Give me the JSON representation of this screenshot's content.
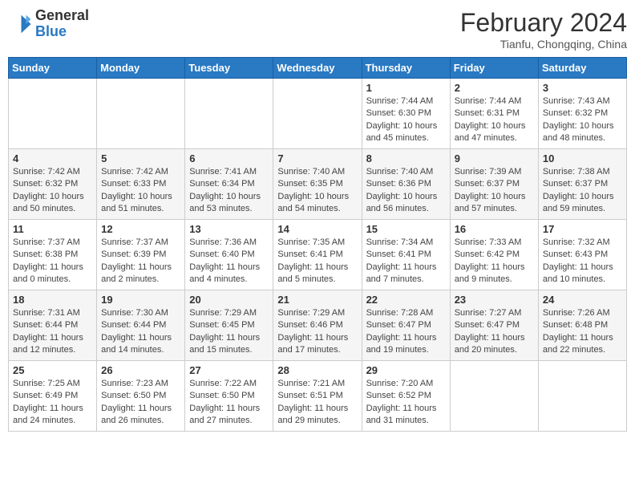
{
  "header": {
    "logo": {
      "general": "General",
      "blue": "Blue"
    },
    "title": "February 2024",
    "location": "Tianfu, Chongqing, China"
  },
  "days_of_week": [
    "Sunday",
    "Monday",
    "Tuesday",
    "Wednesday",
    "Thursday",
    "Friday",
    "Saturday"
  ],
  "weeks": [
    [
      {
        "day": null,
        "info": null
      },
      {
        "day": null,
        "info": null
      },
      {
        "day": null,
        "info": null
      },
      {
        "day": null,
        "info": null
      },
      {
        "day": "1",
        "info": "Sunrise: 7:44 AM\nSunset: 6:30 PM\nDaylight: 10 hours\nand 45 minutes."
      },
      {
        "day": "2",
        "info": "Sunrise: 7:44 AM\nSunset: 6:31 PM\nDaylight: 10 hours\nand 47 minutes."
      },
      {
        "day": "3",
        "info": "Sunrise: 7:43 AM\nSunset: 6:32 PM\nDaylight: 10 hours\nand 48 minutes."
      }
    ],
    [
      {
        "day": "4",
        "info": "Sunrise: 7:42 AM\nSunset: 6:32 PM\nDaylight: 10 hours\nand 50 minutes."
      },
      {
        "day": "5",
        "info": "Sunrise: 7:42 AM\nSunset: 6:33 PM\nDaylight: 10 hours\nand 51 minutes."
      },
      {
        "day": "6",
        "info": "Sunrise: 7:41 AM\nSunset: 6:34 PM\nDaylight: 10 hours\nand 53 minutes."
      },
      {
        "day": "7",
        "info": "Sunrise: 7:40 AM\nSunset: 6:35 PM\nDaylight: 10 hours\nand 54 minutes."
      },
      {
        "day": "8",
        "info": "Sunrise: 7:40 AM\nSunset: 6:36 PM\nDaylight: 10 hours\nand 56 minutes."
      },
      {
        "day": "9",
        "info": "Sunrise: 7:39 AM\nSunset: 6:37 PM\nDaylight: 10 hours\nand 57 minutes."
      },
      {
        "day": "10",
        "info": "Sunrise: 7:38 AM\nSunset: 6:37 PM\nDaylight: 10 hours\nand 59 minutes."
      }
    ],
    [
      {
        "day": "11",
        "info": "Sunrise: 7:37 AM\nSunset: 6:38 PM\nDaylight: 11 hours\nand 0 minutes."
      },
      {
        "day": "12",
        "info": "Sunrise: 7:37 AM\nSunset: 6:39 PM\nDaylight: 11 hours\nand 2 minutes."
      },
      {
        "day": "13",
        "info": "Sunrise: 7:36 AM\nSunset: 6:40 PM\nDaylight: 11 hours\nand 4 minutes."
      },
      {
        "day": "14",
        "info": "Sunrise: 7:35 AM\nSunset: 6:41 PM\nDaylight: 11 hours\nand 5 minutes."
      },
      {
        "day": "15",
        "info": "Sunrise: 7:34 AM\nSunset: 6:41 PM\nDaylight: 11 hours\nand 7 minutes."
      },
      {
        "day": "16",
        "info": "Sunrise: 7:33 AM\nSunset: 6:42 PM\nDaylight: 11 hours\nand 9 minutes."
      },
      {
        "day": "17",
        "info": "Sunrise: 7:32 AM\nSunset: 6:43 PM\nDaylight: 11 hours\nand 10 minutes."
      }
    ],
    [
      {
        "day": "18",
        "info": "Sunrise: 7:31 AM\nSunset: 6:44 PM\nDaylight: 11 hours\nand 12 minutes."
      },
      {
        "day": "19",
        "info": "Sunrise: 7:30 AM\nSunset: 6:44 PM\nDaylight: 11 hours\nand 14 minutes."
      },
      {
        "day": "20",
        "info": "Sunrise: 7:29 AM\nSunset: 6:45 PM\nDaylight: 11 hours\nand 15 minutes."
      },
      {
        "day": "21",
        "info": "Sunrise: 7:29 AM\nSunset: 6:46 PM\nDaylight: 11 hours\nand 17 minutes."
      },
      {
        "day": "22",
        "info": "Sunrise: 7:28 AM\nSunset: 6:47 PM\nDaylight: 11 hours\nand 19 minutes."
      },
      {
        "day": "23",
        "info": "Sunrise: 7:27 AM\nSunset: 6:47 PM\nDaylight: 11 hours\nand 20 minutes."
      },
      {
        "day": "24",
        "info": "Sunrise: 7:26 AM\nSunset: 6:48 PM\nDaylight: 11 hours\nand 22 minutes."
      }
    ],
    [
      {
        "day": "25",
        "info": "Sunrise: 7:25 AM\nSunset: 6:49 PM\nDaylight: 11 hours\nand 24 minutes."
      },
      {
        "day": "26",
        "info": "Sunrise: 7:23 AM\nSunset: 6:50 PM\nDaylight: 11 hours\nand 26 minutes."
      },
      {
        "day": "27",
        "info": "Sunrise: 7:22 AM\nSunset: 6:50 PM\nDaylight: 11 hours\nand 27 minutes."
      },
      {
        "day": "28",
        "info": "Sunrise: 7:21 AM\nSunset: 6:51 PM\nDaylight: 11 hours\nand 29 minutes."
      },
      {
        "day": "29",
        "info": "Sunrise: 7:20 AM\nSunset: 6:52 PM\nDaylight: 11 hours\nand 31 minutes."
      },
      {
        "day": null,
        "info": null
      },
      {
        "day": null,
        "info": null
      }
    ]
  ]
}
